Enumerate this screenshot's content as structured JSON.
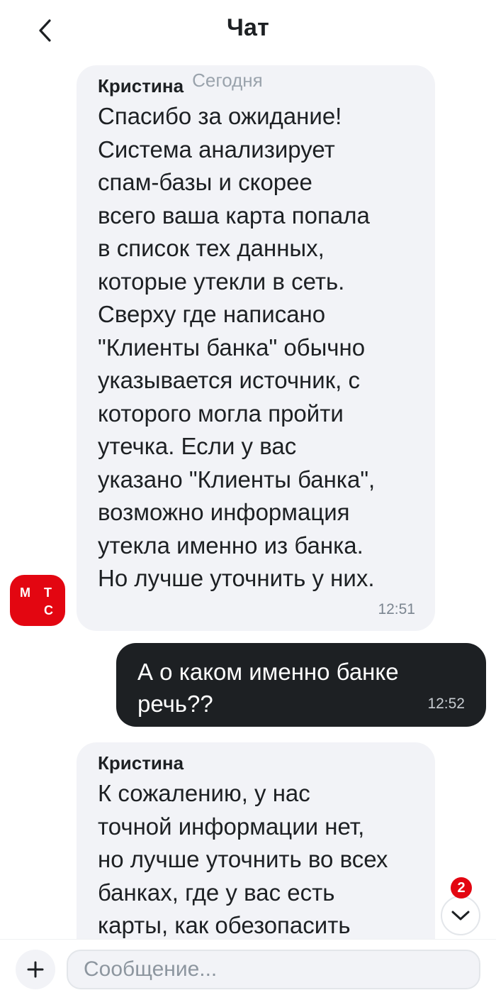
{
  "header": {
    "title": "Чат",
    "back_icon": "chevron-left-icon"
  },
  "messages": [
    {
      "direction": "incoming",
      "sender": "Кристина",
      "date": "Сегодня",
      "text": "Спасибо за ожидание!\nСистема анализирует\nспам-базы и скорее\nвсего ваша карта попала\nв список тех данных,\nкоторые утекли в сеть.\nСверху где написано\n\"Клиенты банка\" обычно\nуказывается источник, с\nкоторого могла пройти\nутечка. Если у вас\nуказано \"Клиенты банка\",\nвозможно информация\nутекла именно из банка.\nНо лучше уточнить у них.",
      "time": "12:51"
    },
    {
      "direction": "outgoing",
      "text": "А о каком именно банке\nречь??",
      "time": "12:52"
    },
    {
      "direction": "incoming",
      "sender": "Кристина",
      "text": "К сожалению, у нас\nточной информации нет,\nно лучше уточнить во всех\nбанках, где у вас есть\nкарты, как обезопасить"
    }
  ],
  "avatar": {
    "letters": [
      "М",
      "Т",
      "С"
    ],
    "color": "#e30611"
  },
  "scroll_down": {
    "unread_count": "2",
    "icon": "chevron-down-icon"
  },
  "composer": {
    "placeholder": "Сообщение...",
    "attach_icon": "plus-icon"
  },
  "colors": {
    "accent": "#e30611",
    "incoming_bg": "#f2f3f7",
    "outgoing_bg": "#1d2023"
  }
}
